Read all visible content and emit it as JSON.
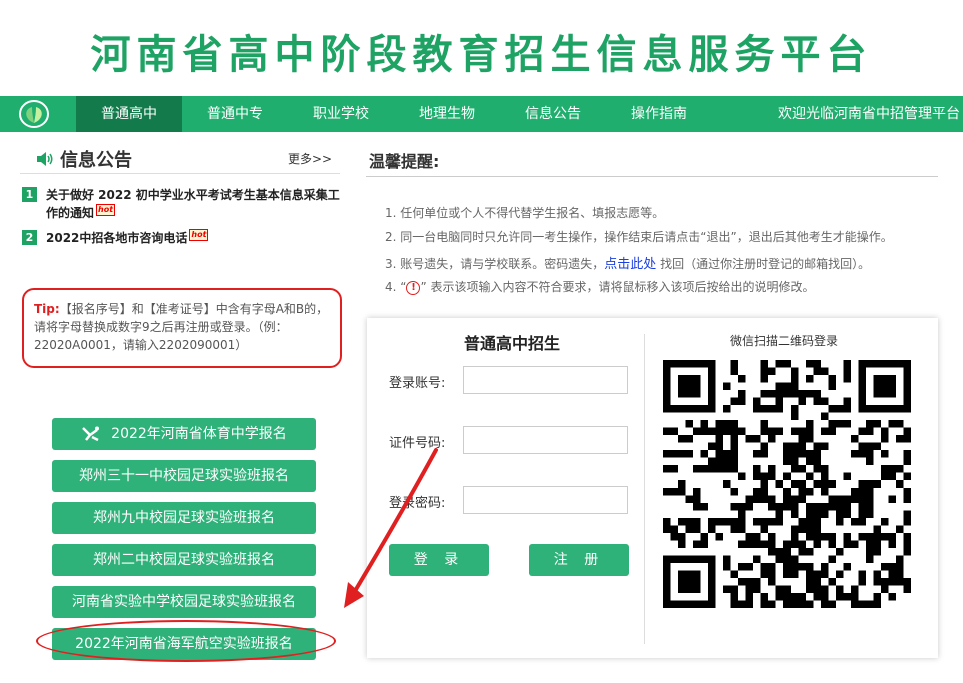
{
  "site": {
    "title": "河南省高中阶段教育招生信息服务平台"
  },
  "nav": {
    "items": [
      {
        "label": "普通高中",
        "active": true
      },
      {
        "label": "普通中专",
        "active": false
      },
      {
        "label": "职业学校",
        "active": false
      },
      {
        "label": "地理生物",
        "active": false
      },
      {
        "label": "信息公告",
        "active": false
      },
      {
        "label": "操作指南",
        "active": false
      }
    ],
    "welcome": "欢迎光临河南省中招管理平台"
  },
  "notices": {
    "title": "信息公告",
    "more": "更多>>",
    "items": [
      {
        "num": "1",
        "text": "关于做好 2022 初中学业水平考试考生基本信息采集工作的通知",
        "badge": "hot"
      },
      {
        "num": "2",
        "text": "2022中招各地市咨询电话",
        "badge": "hot"
      }
    ]
  },
  "tip": {
    "label": "Tip:",
    "text": "【报名序号】和【准考证号】中含有字母A和B的，请将字母替换成数字9之后再注册或登录。（例：22020A0001，请输入2202090001）"
  },
  "side_buttons": [
    "2022年河南省体育中学报名",
    "郑州三十一中校园足球实验班报名",
    "郑州九中校园足球实验班报名",
    "郑州二中校园足球实验班报名",
    "河南省实验中学校园足球实验班报名",
    "2022年河南省海军航空实验班报名"
  ],
  "reminder": {
    "title": "温馨提醒:",
    "item1": "1. 任何单位或个人不得代替学生报名、填报志愿等。",
    "item2": "2. 同一台电脑同时只允许同一考生操作，操作结束后请点击“退出”，退出后其他考生才能操作。",
    "item3_before": "3. 账号遗失，请与学校联系。密码遗失，",
    "item3_link": "点击此处",
    "item3_after": " 找回（通过你注册时登记的邮箱找回）。",
    "item4_before": "4. “",
    "item4_icon": "!",
    "item4_after": "” 表示该项输入内容不符合要求，请将鼠标移入该项后按给出的说明修改。"
  },
  "login": {
    "title": "普通高中招生",
    "account_label": "登录账号:",
    "account_value": "",
    "id_label": "证件号码:",
    "id_value": "",
    "password_label": "登录密码:",
    "password_value": "",
    "login_button": "登 录",
    "register_button": "注 册",
    "qr_title": "微信扫描二维码登录"
  },
  "colors": {
    "brand_green": "#1fae6e",
    "nav_active": "#137a4b",
    "alert_red": "#e02020",
    "link_blue": "#1a3ee0"
  }
}
